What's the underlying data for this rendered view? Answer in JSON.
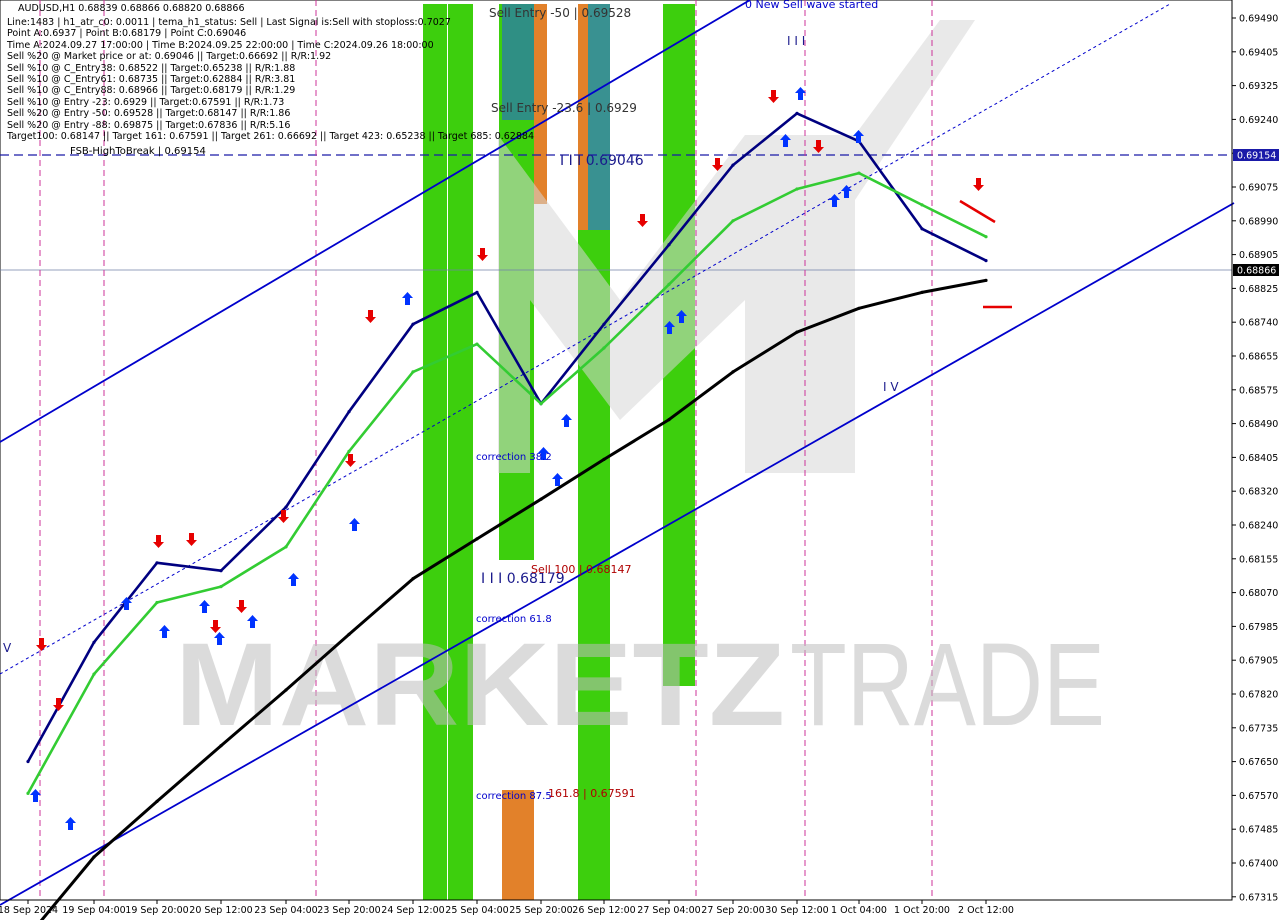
{
  "header": {
    "symbol_line": "AUDUSD,H1  0.68839 0.68866 0.68820 0.68866",
    "info_lines": [
      "Line:1483 | h1_atr_c0: 0.0011 | tema_h1_status: Sell | Last Signal is:Sell with stoploss:0.7027",
      "Point A:0.6937 | Point B:0.68179 | Point C:0.69046",
      "Time A:2024.09.27 17:00:00 | Time B:2024.09.25 22:00:00 | Time C:2024.09.26 18:00:00",
      "Sell %20 @ Market price or at: 0.69046 || Target:0.66692 || R/R:1.92",
      "Sell %10 @ C_Entry38: 0.68522 || Target:0.65238 || R/R:1.88",
      "Sell %10 @ C_Entry61: 0.68735 || Target:0.62884 || R/R:3.81",
      "Sell %10 @ C_Entry88: 0.68966 || Target:0.68179 || R/R:1.29",
      "Sell %10 @ Entry -23: 0.6929 || Target:0.67591 || R/R:1.73",
      "Sell %20 @ Entry -50: 0.69528 || Target:0.68147 || R/R:1.86",
      "Sell %20 @ Entry -88: 0.69875 || Target:0.67836 || R/R:5.16",
      "Target100: 0.68147 || Target 161: 0.67591 || Target 261: 0.66692 || Target 423: 0.65238 || Target 685: 0.62884"
    ]
  },
  "annotations": {
    "new_sell_wave": "0 New Sell wave started",
    "sell_entry_50": "Sell Entry -50 | 0.69528",
    "sell_entry_23": "Sell Entry -23.6 | 0.6929",
    "point_c_label": "I I I 0.69046",
    "fsb_label": "FSB-HighToBreak | 0.69154",
    "correction_38": "correction 38.2",
    "correction_61": "correction 61.8",
    "correction_87": "correction 87.5",
    "point_b_label": "I I I 0.68179",
    "sell_100": "Sell 100 | 0.68147",
    "target_161": "161.8 | 0.67591",
    "point_a_marker": "I I I",
    "low_marker": "I V",
    "left_marker": "V"
  },
  "watermark": {
    "left": "MARKETZ",
    "right": "TRADE"
  },
  "price_axis": {
    "ticks": [
      "0.69490",
      "0.69405",
      "0.69325",
      "0.69240",
      "0.69155",
      "0.69075",
      "0.68990",
      "0.68905",
      "0.68825",
      "0.68740",
      "0.68655",
      "0.68575",
      "0.68490",
      "0.68405",
      "0.68320",
      "0.68240",
      "0.68155",
      "0.68070",
      "0.67985",
      "0.67905",
      "0.67820",
      "0.67735",
      "0.67650",
      "0.67570",
      "0.67485",
      "0.67400",
      "0.67315"
    ],
    "tag_fsb": "0.69154",
    "tag_current": "0.68866"
  },
  "time_axis": {
    "labels": [
      "18 Sep 2024",
      "19 Sep 04:00",
      "19 Sep 20:00",
      "20 Sep 12:00",
      "23 Sep 04:00",
      "23 Sep 20:00",
      "24 Sep 12:00",
      "25 Sep 04:00",
      "25 Sep 20:00",
      "26 Sep 12:00",
      "27 Sep 04:00",
      "27 Sep 20:00",
      "30 Sep 12:00",
      "1 Oct 04:00",
      "1 Oct 20:00",
      "2 Oct 12:00"
    ]
  },
  "colors": {
    "bull_zone": "#33cc00",
    "bear_zone": "#e07a1f",
    "teal_zone": "#2e8b8b",
    "channel": "#0000cc",
    "ma_slow": "#000000",
    "ma_mid": "#33cc33",
    "ma_fast": "#000080",
    "sell_arrow": "#e60000",
    "buy_arrow": "#0033ff",
    "annotation_blue": "#0000cc",
    "annotation_red": "#b00000"
  },
  "chart_data": {
    "type": "line",
    "title": "AUDUSD,H1",
    "ylim": [
      0.67315,
      0.6949
    ],
    "x": [
      "18 Sep 2024",
      "19 Sep 04:00",
      "19 Sep 20:00",
      "20 Sep 12:00",
      "23 Sep 04:00",
      "23 Sep 20:00",
      "24 Sep 12:00",
      "25 Sep 04:00",
      "25 Sep 20:00",
      "26 Sep 12:00",
      "27 Sep 04:00",
      "27 Sep 20:00",
      "30 Sep 12:00",
      "1 Oct 04:00",
      "1 Oct 20:00",
      "2 Oct 12:00"
    ],
    "series": [
      {
        "values": [
          0.6762,
          0.6792,
          0.6812,
          0.681,
          0.6826,
          0.685,
          0.6872,
          0.688,
          0.6852,
          0.6872,
          0.6892,
          0.6912,
          0.6925,
          0.6918,
          0.6896,
          0.6888
        ]
      },
      {
        "values": [
          0.6754,
          0.6784,
          0.6802,
          0.6806,
          0.6816,
          0.684,
          0.686,
          0.6867,
          0.6852,
          0.6866,
          0.6882,
          0.6898,
          0.6906,
          0.691,
          0.6902,
          0.6894
        ]
      },
      {
        "values": [
          0.6718,
          0.6738,
          0.6752,
          0.6766,
          0.678,
          0.6794,
          0.6808,
          0.6818,
          0.6828,
          0.6838,
          0.6848,
          0.686,
          0.687,
          0.6876,
          0.688,
          0.6883
        ]
      }
    ],
    "levels": [
      {
        "label": "FSB-HighToBreak",
        "value": 0.69154
      },
      {
        "label": "current",
        "value": 0.68866
      }
    ]
  }
}
